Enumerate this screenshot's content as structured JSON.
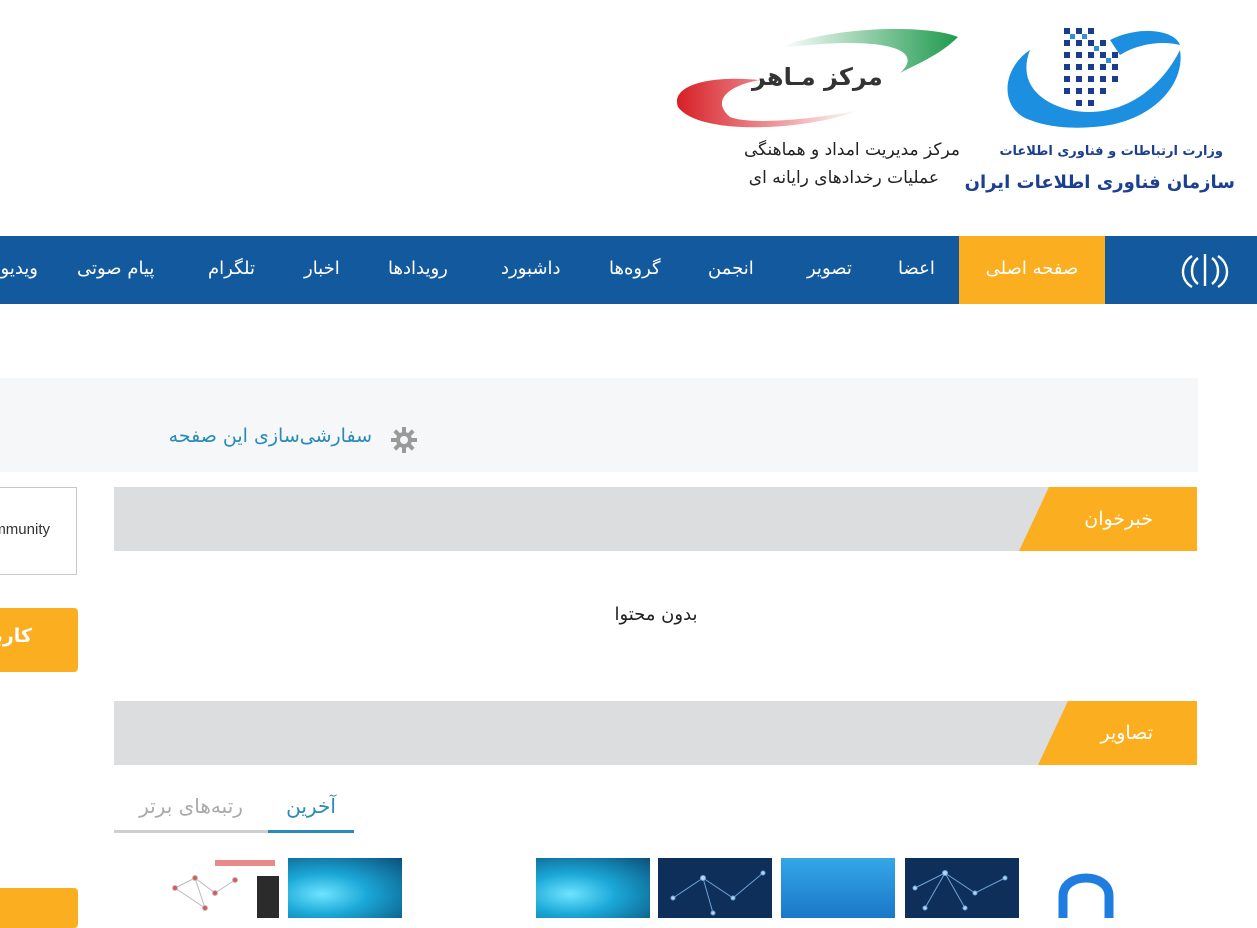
{
  "header": {
    "ministry_name": "وزارت ارتباطات و فناوری اطلاعات",
    "org_name": "سازمان فناوری اطلاعات ایران",
    "maher_logo_text": "مرکز مـاهر",
    "center_line1": "مرکز مدیریت امداد و هماهنگی",
    "center_line2": "عملیات رخدادهای رایانه ای"
  },
  "nav": {
    "items": [
      {
        "label": "صفحه اصلی",
        "active": true
      },
      {
        "label": "اعضا"
      },
      {
        "label": "تصویر"
      },
      {
        "label": "انجمن"
      },
      {
        "label": "گروه‌ها"
      },
      {
        "label": "داشبورد"
      },
      {
        "label": "رویدادها"
      },
      {
        "label": "اخبار"
      },
      {
        "label": "تلگرام"
      },
      {
        "label": "پیام صوتی"
      },
      {
        "label": "ویدیو"
      }
    ],
    "emblem_icon": "iran-emblem-icon"
  },
  "customize": {
    "label": "سفارشی‌سازی این صفحه",
    "icon": "gear-icon"
  },
  "news_section": {
    "title": "خبرخوان",
    "empty_text": "بدون محتوا"
  },
  "images_section": {
    "title": "تصاویر",
    "tabs": [
      {
        "label": "آخرین",
        "active": true
      },
      {
        "label": "رتبه‌های برتر",
        "active": false
      }
    ]
  },
  "sidebar": {
    "community_text": "Community",
    "users_button_label": "کاربران"
  },
  "colors": {
    "nav_bg": "#13599e",
    "accent": "#fbae1f",
    "link": "#2a8ab8",
    "section_bg": "#dcdddf"
  }
}
